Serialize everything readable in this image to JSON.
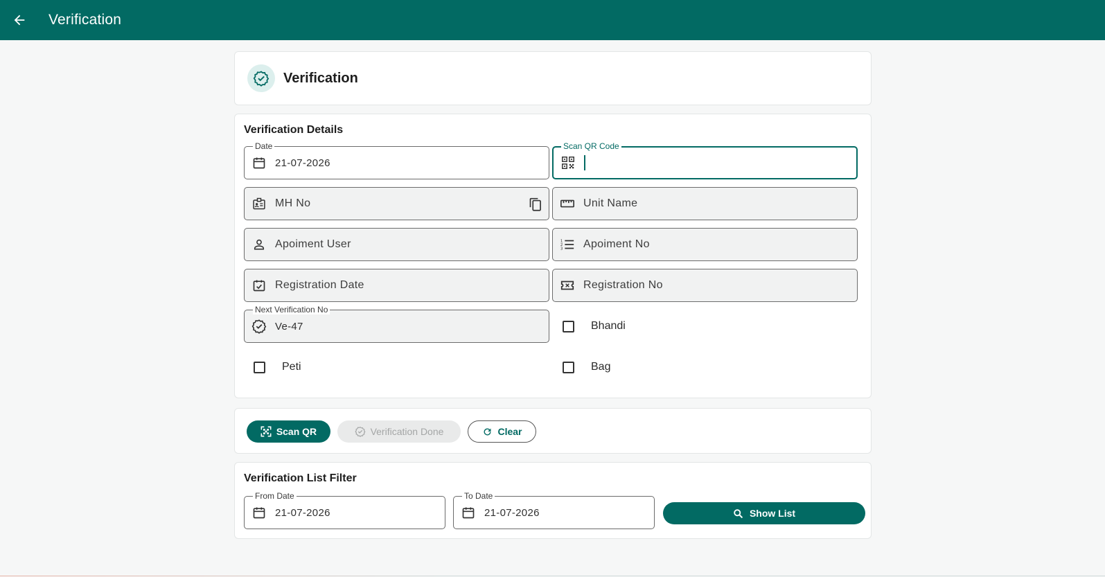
{
  "appbar": {
    "title": "Verification"
  },
  "header": {
    "title": "Verification"
  },
  "details": {
    "title": "Verification Details",
    "date": {
      "label": "Date",
      "value": "21-07-2026"
    },
    "scan_qr": {
      "label": "Scan QR Code",
      "value": ""
    },
    "mh_no": {
      "placeholder": "MH No"
    },
    "unit_name": {
      "placeholder": "Unit Name"
    },
    "appointment_user": {
      "placeholder": "Apoiment User"
    },
    "appointment_no": {
      "placeholder": "Apoiment No"
    },
    "registration_date": {
      "placeholder": "Registration Date"
    },
    "registration_no": {
      "placeholder": "Registration No"
    },
    "next_verification": {
      "label": "Next Verification No",
      "value": "Ve-47"
    },
    "checkboxes": {
      "bhandi": "Bhandi",
      "peti": "Peti",
      "bag": "Bag"
    }
  },
  "actions": {
    "scan_qr": "Scan QR",
    "verification_done": "Verification Done",
    "clear": "Clear"
  },
  "filter": {
    "title": "Verification List Filter",
    "from_date": {
      "label": "From Date",
      "value": "21-07-2026"
    },
    "to_date": {
      "label": "To Date",
      "value": "21-07-2026"
    },
    "show_list": "Show List"
  },
  "colors": {
    "primary": "#026a63",
    "badge_bg": "#dcefed",
    "disabled_text": "#a4a6a6"
  }
}
